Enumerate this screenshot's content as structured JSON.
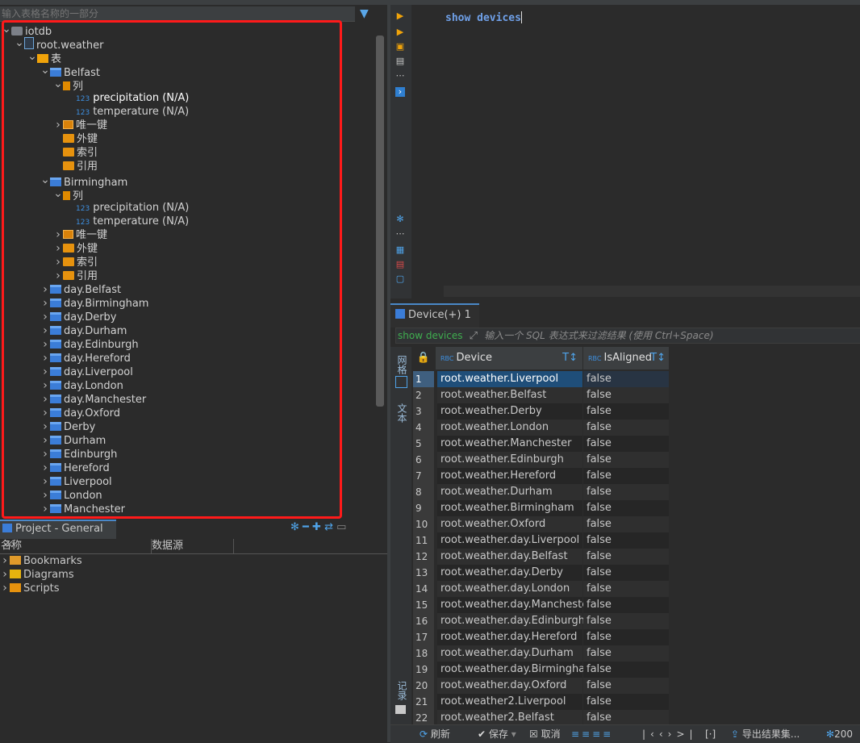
{
  "left_panel": {
    "filter_placeholder": "输入表格名称的一部分",
    "tree": [
      {
        "label": "iotdb",
        "depth": 0,
        "chev": "v",
        "icon": "database-icon",
        "kind": "db"
      },
      {
        "label": "root.weather",
        "depth": 1,
        "chev": "v",
        "icon": "schema-icon",
        "kind": "sch"
      },
      {
        "label": "表",
        "depth": 2,
        "chev": "v",
        "icon": "tables-folder-icon",
        "kind": "tbls"
      },
      {
        "label": "Belfast",
        "depth": 3,
        "chev": "v",
        "icon": "table-icon",
        "kind": "tbl"
      },
      {
        "label": "列",
        "depth": 4,
        "chev": "v",
        "icon": "columns-icon",
        "kind": "col"
      },
      {
        "label": "precipitation (N/A)",
        "depth": 5,
        "chev": "",
        "icon": "numeric-column-icon",
        "kind": "num",
        "highlight": true
      },
      {
        "label": "temperature (N/A)",
        "depth": 5,
        "chev": "",
        "icon": "numeric-column-icon",
        "kind": "num"
      },
      {
        "label": "唯一键",
        "depth": 4,
        "chev": ">",
        "icon": "unique-key-icon",
        "kind": "key"
      },
      {
        "label": "外键",
        "depth": 4,
        "chev": "",
        "icon": "folder-icon",
        "kind": "fold"
      },
      {
        "label": "索引",
        "depth": 4,
        "chev": "",
        "icon": "folder-icon",
        "kind": "fold"
      },
      {
        "label": "引用",
        "depth": 4,
        "chev": "",
        "icon": "folder-icon",
        "kind": "fold"
      },
      {
        "label": "Birmingham",
        "depth": 3,
        "chev": "v",
        "icon": "table-icon",
        "kind": "tbl"
      },
      {
        "label": "列",
        "depth": 4,
        "chev": "v",
        "icon": "columns-icon",
        "kind": "col"
      },
      {
        "label": "precipitation (N/A)",
        "depth": 5,
        "chev": "",
        "icon": "numeric-column-icon",
        "kind": "num"
      },
      {
        "label": "temperature (N/A)",
        "depth": 5,
        "chev": "",
        "icon": "numeric-column-icon",
        "kind": "num"
      },
      {
        "label": "唯一键",
        "depth": 4,
        "chev": ">",
        "icon": "unique-key-icon",
        "kind": "key"
      },
      {
        "label": "外键",
        "depth": 4,
        "chev": ">",
        "icon": "folder-icon",
        "kind": "fold"
      },
      {
        "label": "索引",
        "depth": 4,
        "chev": ">",
        "icon": "folder-icon",
        "kind": "fold"
      },
      {
        "label": "引用",
        "depth": 4,
        "chev": ">",
        "icon": "folder-icon",
        "kind": "fold"
      },
      {
        "label": "day.Belfast",
        "depth": 3,
        "chev": ">",
        "icon": "table-icon",
        "kind": "tbl"
      },
      {
        "label": "day.Birmingham",
        "depth": 3,
        "chev": ">",
        "icon": "table-icon",
        "kind": "tbl"
      },
      {
        "label": "day.Derby",
        "depth": 3,
        "chev": ">",
        "icon": "table-icon",
        "kind": "tbl"
      },
      {
        "label": "day.Durham",
        "depth": 3,
        "chev": ">",
        "icon": "table-icon",
        "kind": "tbl"
      },
      {
        "label": "day.Edinburgh",
        "depth": 3,
        "chev": ">",
        "icon": "table-icon",
        "kind": "tbl"
      },
      {
        "label": "day.Hereford",
        "depth": 3,
        "chev": ">",
        "icon": "table-icon",
        "kind": "tbl"
      },
      {
        "label": "day.Liverpool",
        "depth": 3,
        "chev": ">",
        "icon": "table-icon",
        "kind": "tbl"
      },
      {
        "label": "day.London",
        "depth": 3,
        "chev": ">",
        "icon": "table-icon",
        "kind": "tbl"
      },
      {
        "label": "day.Manchester",
        "depth": 3,
        "chev": ">",
        "icon": "table-icon",
        "kind": "tbl"
      },
      {
        "label": "day.Oxford",
        "depth": 3,
        "chev": ">",
        "icon": "table-icon",
        "kind": "tbl"
      },
      {
        "label": "Derby",
        "depth": 3,
        "chev": ">",
        "icon": "table-icon",
        "kind": "tbl"
      },
      {
        "label": "Durham",
        "depth": 3,
        "chev": ">",
        "icon": "table-icon",
        "kind": "tbl"
      },
      {
        "label": "Edinburgh",
        "depth": 3,
        "chev": ">",
        "icon": "table-icon",
        "kind": "tbl"
      },
      {
        "label": "Hereford",
        "depth": 3,
        "chev": ">",
        "icon": "table-icon",
        "kind": "tbl"
      },
      {
        "label": "Liverpool",
        "depth": 3,
        "chev": ">",
        "icon": "table-icon",
        "kind": "tbl"
      },
      {
        "label": "London",
        "depth": 3,
        "chev": ">",
        "icon": "table-icon",
        "kind": "tbl"
      },
      {
        "label": "Manchester",
        "depth": 3,
        "chev": ">",
        "icon": "table-icon",
        "kind": "tbl"
      }
    ]
  },
  "project": {
    "tab_label": "Project - General",
    "columns": [
      "名称",
      "数据源"
    ],
    "items": [
      {
        "label": "Bookmarks",
        "icon": "bookmarks-folder-icon"
      },
      {
        "label": "Diagrams",
        "icon": "diagrams-folder-icon"
      },
      {
        "label": "Scripts",
        "icon": "scripts-folder-icon"
      }
    ]
  },
  "editor": {
    "code": "show devices"
  },
  "results": {
    "tab_label": "Device(+) 1",
    "query_text": "show devices",
    "filter_placeholder": "输入一个 SQL 表达式来过滤结果 (使用 Ctrl+Space)",
    "side_tabs": [
      "网格",
      "文本",
      "记录"
    ],
    "columns": [
      "Device",
      "IsAligned"
    ],
    "rows": [
      [
        "1",
        "root.weather.Liverpool",
        "false"
      ],
      [
        "2",
        "root.weather.Belfast",
        "false"
      ],
      [
        "3",
        "root.weather.Derby",
        "false"
      ],
      [
        "4",
        "root.weather.London",
        "false"
      ],
      [
        "5",
        "root.weather.Manchester",
        "false"
      ],
      [
        "6",
        "root.weather.Edinburgh",
        "false"
      ],
      [
        "7",
        "root.weather.Hereford",
        "false"
      ],
      [
        "8",
        "root.weather.Durham",
        "false"
      ],
      [
        "9",
        "root.weather.Birmingham",
        "false"
      ],
      [
        "10",
        "root.weather.Oxford",
        "false"
      ],
      [
        "11",
        "root.weather.day.Liverpool",
        "false"
      ],
      [
        "12",
        "root.weather.day.Belfast",
        "false"
      ],
      [
        "13",
        "root.weather.day.Derby",
        "false"
      ],
      [
        "14",
        "root.weather.day.London",
        "false"
      ],
      [
        "15",
        "root.weather.day.Manchester",
        "false"
      ],
      [
        "16",
        "root.weather.day.Edinburgh",
        "false"
      ],
      [
        "17",
        "root.weather.day.Hereford",
        "false"
      ],
      [
        "18",
        "root.weather.day.Durham",
        "false"
      ],
      [
        "19",
        "root.weather.day.Birmingham",
        "false"
      ],
      [
        "20",
        "root.weather.day.Oxford",
        "false"
      ],
      [
        "21",
        "root.weather2.Liverpool",
        "false"
      ],
      [
        "22",
        "root.weather2.Belfast",
        "false"
      ]
    ],
    "status": {
      "refresh": "刷新",
      "save": "保存",
      "cancel": "取消",
      "export": "导出结果集...",
      "fetch_size": "200"
    }
  },
  "colors": {
    "accent": "#4a88c7",
    "highlight_box": "#ff1a1a",
    "selection": "#1f4e79"
  }
}
